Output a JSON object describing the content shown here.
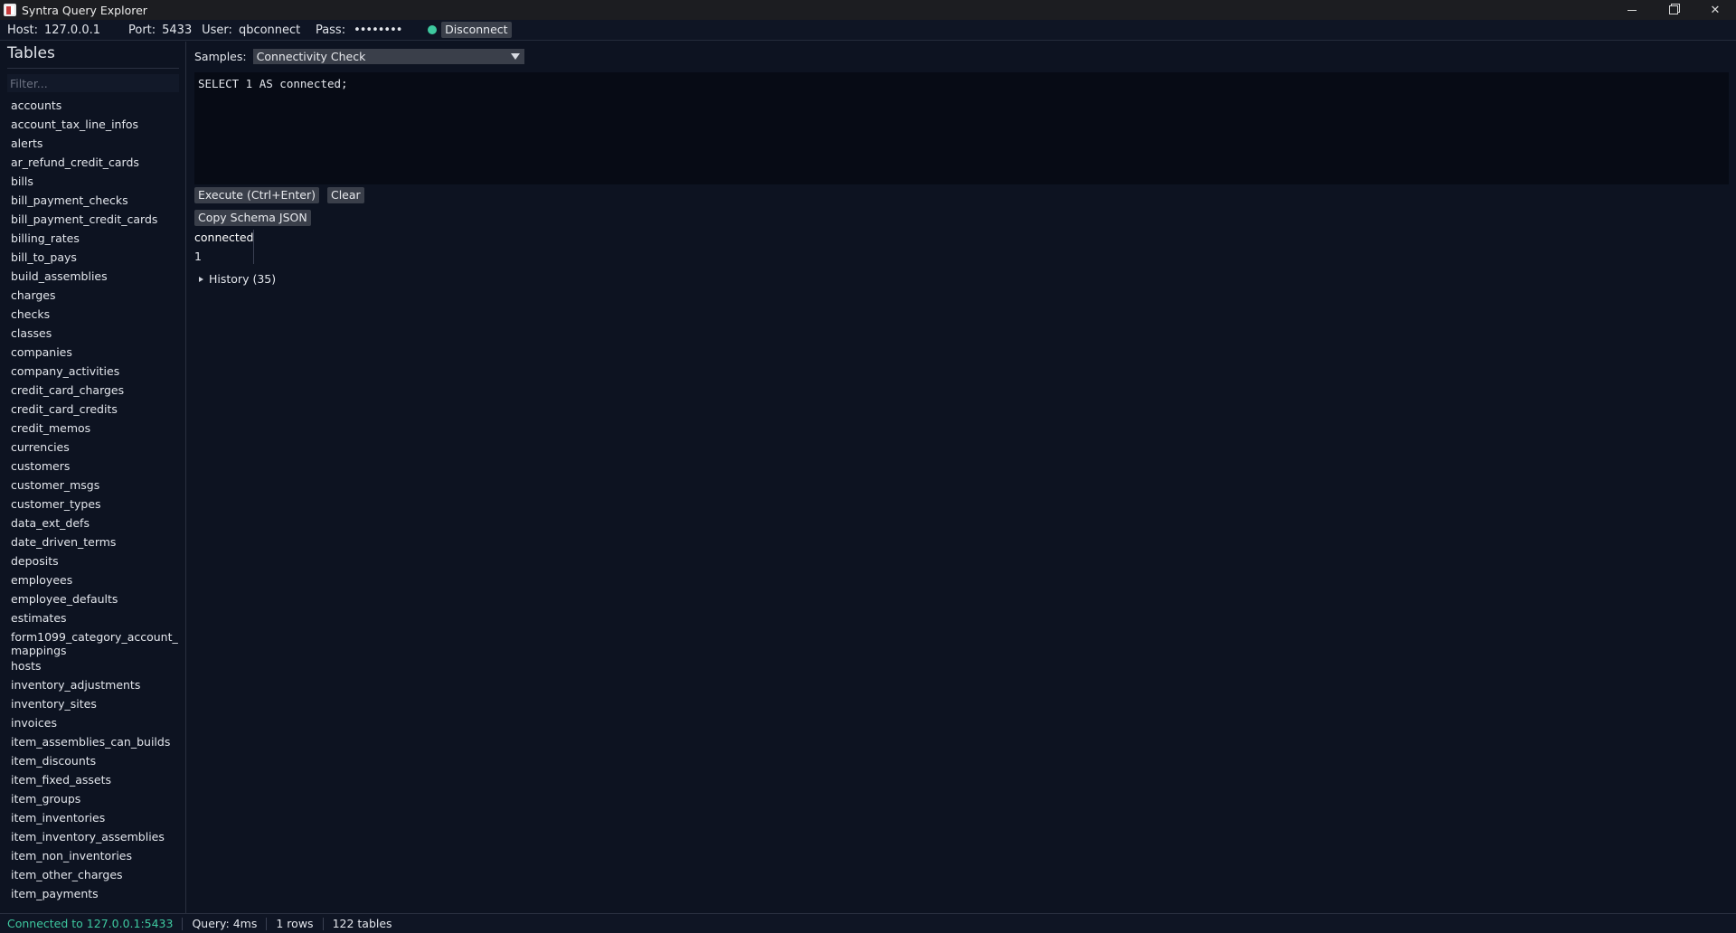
{
  "window": {
    "title": "Syntra Query Explorer"
  },
  "connection": {
    "host_label": "Host:",
    "host_value": "127.0.0.1",
    "port_label": "Port:",
    "port_value": "5433",
    "user_label": "User:",
    "user_value": "qbconnect",
    "pass_label": "Pass:",
    "pass_value": "••••••••",
    "status_color": "#3ec9a0",
    "disconnect_label": "Disconnect"
  },
  "sidebar": {
    "title": "Tables",
    "filter_placeholder": "Filter...",
    "tables": [
      "accounts",
      "account_tax_line_infos",
      "alerts",
      "ar_refund_credit_cards",
      "bills",
      "bill_payment_checks",
      "bill_payment_credit_cards",
      "billing_rates",
      "bill_to_pays",
      "build_assemblies",
      "charges",
      "checks",
      "classes",
      "companies",
      "company_activities",
      "credit_card_charges",
      "credit_card_credits",
      "credit_memos",
      "currencies",
      "customers",
      "customer_msgs",
      "customer_types",
      "data_ext_defs",
      "date_driven_terms",
      "deposits",
      "employees",
      "employee_defaults",
      "estimates",
      "form1099_category_account_ mappings",
      "hosts",
      "inventory_adjustments",
      "inventory_sites",
      "invoices",
      "item_assemblies_can_builds",
      "item_discounts",
      "item_fixed_assets",
      "item_groups",
      "item_inventories",
      "item_inventory_assemblies",
      "item_non_inventories",
      "item_other_charges",
      "item_payments"
    ]
  },
  "query": {
    "samples_label": "Samples:",
    "samples_selected": "Connectivity Check",
    "sql": "SELECT 1 AS connected;",
    "execute_label": "Execute (Ctrl+Enter)",
    "clear_label": "Clear",
    "copy_schema_label": "Copy Schema JSON"
  },
  "result": {
    "columns": [
      "connected"
    ],
    "rows": [
      [
        "1"
      ]
    ]
  },
  "history": {
    "label": "History (35)"
  },
  "status": {
    "connected_text": "Connected to 127.0.0.1:5433",
    "query_time": "Query: 4ms",
    "rows": "1 rows",
    "tables": "122 tables"
  }
}
